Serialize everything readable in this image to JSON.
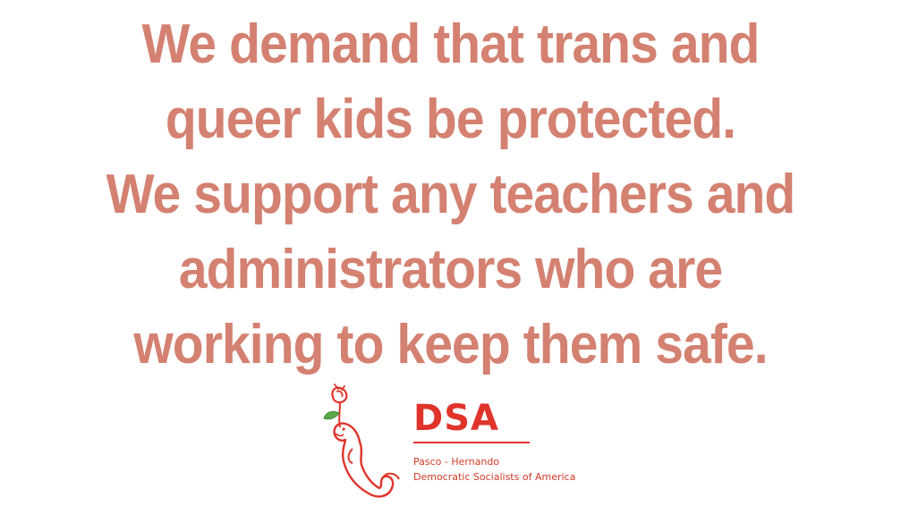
{
  "statement": {
    "lines": [
      "We demand that trans and",
      "queer kids be protected.",
      "We support any teachers and",
      "administrators who are",
      "working to keep them safe."
    ],
    "color": "#d48171"
  },
  "logo": {
    "title": "DSA",
    "chapter": "Pasco - Hernando",
    "organization": "Democratic Socialists of America",
    "accent_color": "#e0342b",
    "leaf_color": "#5aa84a",
    "icon_name": "rose-manatee-icon"
  }
}
